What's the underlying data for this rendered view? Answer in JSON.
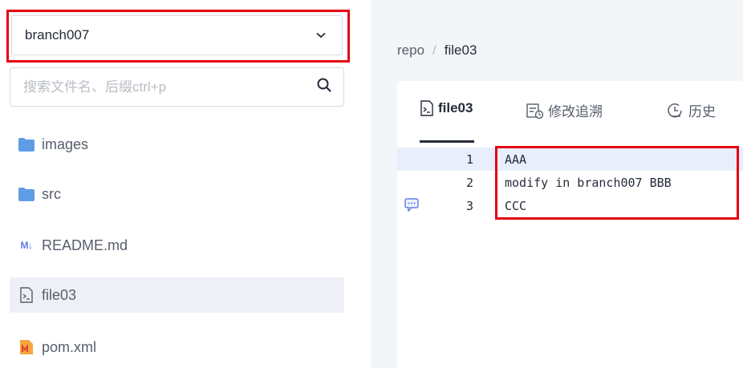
{
  "sidebar": {
    "branch": "branch007",
    "search_placeholder": "搜索文件名、后缀ctrl+p",
    "items": [
      {
        "label": "images",
        "icon": "folder-icon"
      },
      {
        "label": "src",
        "icon": "folder-icon"
      },
      {
        "label": "README.md",
        "icon": "markdown-icon",
        "badge": "M↓"
      },
      {
        "label": "file03",
        "icon": "file-icon",
        "active": true
      },
      {
        "label": "pom.xml",
        "icon": "maven-file-icon"
      }
    ]
  },
  "breadcrumb": {
    "root": "repo",
    "sep": "/",
    "current": "file03"
  },
  "tabs": [
    {
      "label": "file03",
      "icon": "file-icon",
      "active": true
    },
    {
      "label": "修改追溯",
      "icon": "blame-icon"
    },
    {
      "label": "历史",
      "icon": "history-icon"
    }
  ],
  "code": [
    {
      "num": "1",
      "text": "AAA"
    },
    {
      "num": "2",
      "text": "modify in branch007 BBB"
    },
    {
      "num": "3",
      "text": "CCC"
    }
  ],
  "colors": {
    "highlight_outline": "#e60012",
    "folder": "#5e9ce8",
    "accent": "#5e7ce0"
  }
}
